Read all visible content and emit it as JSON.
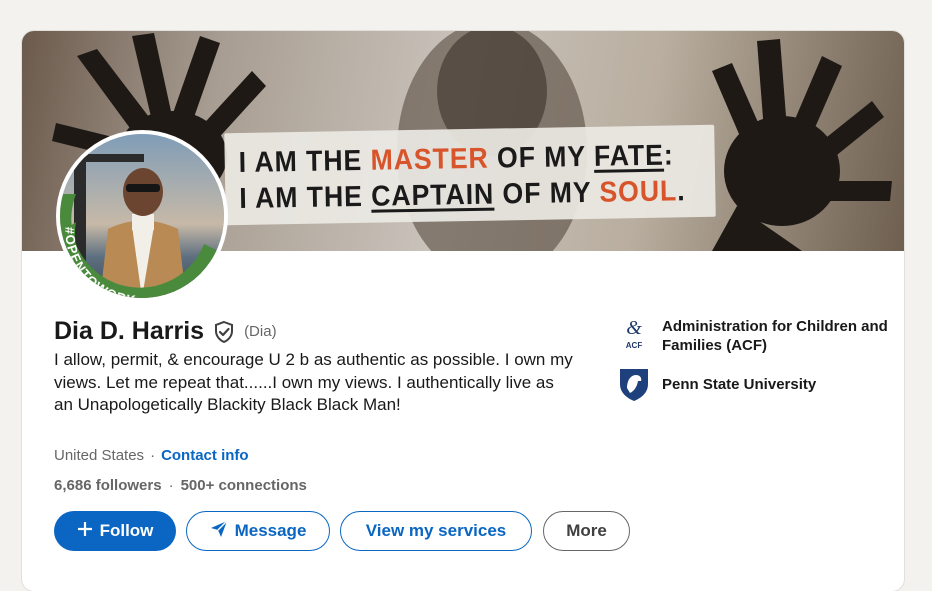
{
  "banner": {
    "quote": {
      "l1_a": "I AM THE ",
      "l1_b": "MASTER",
      "l1_c": " OF MY ",
      "l1_d": "FATE",
      "l1_e": ":",
      "l2_a": "I AM THE ",
      "l2_b": "CAPTAIN",
      "l2_c": " OF MY ",
      "l2_d": "SOUL",
      "l2_e": "."
    },
    "accent_color": "#d8542a"
  },
  "profile": {
    "avatar_badge": "#OPENTOWORK",
    "name": "Dia D. Harris",
    "pronoun": "(Dia)",
    "headline": "I allow, permit, & encourage U 2 b as authentic as possible. I own my views. Let me repeat that......I own my views. I authentically live as an Unapologetically Blackity Black Black Man!",
    "location": "United States",
    "location_sep": "·",
    "contact_label": "Contact info",
    "followers": "6,686 followers",
    "connections_sep": "·",
    "connections": "500+ connections"
  },
  "actions": {
    "follow": "Follow",
    "message": "Message",
    "services": "View my services",
    "more": "More"
  },
  "organizations": [
    {
      "name": "Administration for Children and Families (ACF)",
      "logo_text": "ACF",
      "logo_icon": "acf-logo-icon"
    },
    {
      "name": "Penn State University",
      "logo_icon": "nittany-lion-shield-icon"
    }
  ],
  "colors": {
    "brand_blue": "#0a66c2",
    "open_to_work_green": "#4a8a3c"
  }
}
